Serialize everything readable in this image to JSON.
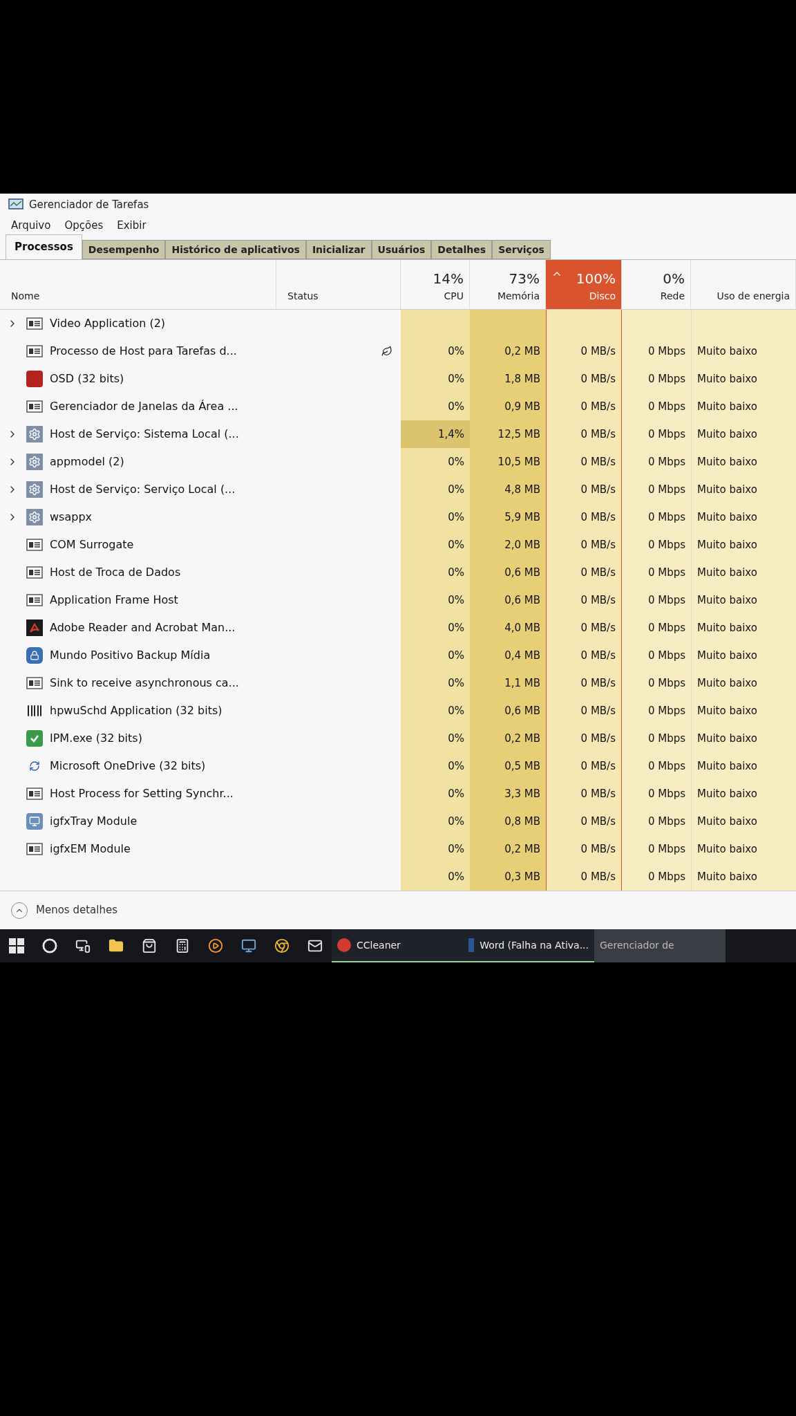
{
  "window": {
    "title": "Gerenciador de Tarefas"
  },
  "menu": [
    "Arquivo",
    "Opções",
    "Exibir"
  ],
  "tabs": [
    {
      "label": "Processos",
      "selected": true
    },
    {
      "label": "Desempenho",
      "selected": false
    },
    {
      "label": "Histórico de aplicativos",
      "selected": false
    },
    {
      "label": "Inicializar",
      "selected": false
    },
    {
      "label": "Usuários",
      "selected": false
    },
    {
      "label": "Detalhes",
      "selected": false
    },
    {
      "label": "Serviços",
      "selected": false
    }
  ],
  "table": {
    "columns": [
      {
        "label": "Nome",
        "alert": false,
        "sorted": false
      },
      {
        "label": "Status",
        "alert": false,
        "sorted": false
      },
      {
        "label": "CPU",
        "total": "14%",
        "alert": false,
        "sorted": false
      },
      {
        "label": "Memória",
        "total": "73%",
        "alert": false,
        "sorted": false
      },
      {
        "label": "Disco",
        "total": "100%",
        "alert": true,
        "sorted": true
      },
      {
        "label": "Rede",
        "total": "0%",
        "alert": false,
        "sorted": false
      },
      {
        "label": "Uso de energia",
        "alert": false,
        "sorted": false
      }
    ],
    "rows": [
      {
        "name": "Video Application (2)",
        "kind": "window",
        "expandable": true,
        "suspended": false,
        "cpu_high": false
      },
      {
        "name": "Processo de Host para Tarefas d...",
        "kind": "window",
        "expandable": false,
        "suspended": true,
        "cpu_high": false,
        "cpu": "0%",
        "memory": "0,2 MB",
        "disk": "0 MB/s",
        "network": "0 Mbps",
        "power": "Muito baixo"
      },
      {
        "name": "OSD (32 bits)",
        "kind": "osd",
        "expandable": false,
        "suspended": false,
        "cpu_high": false,
        "cpu": "0%",
        "memory": "1,8 MB",
        "disk": "0 MB/s",
        "network": "0 Mbps",
        "power": "Muito baixo"
      },
      {
        "name": "Gerenciador de Janelas da Área ...",
        "kind": "window",
        "expandable": false,
        "suspended": false,
        "cpu_high": false,
        "cpu": "0%",
        "memory": "0,9 MB",
        "disk": "0 MB/s",
        "network": "0 Mbps",
        "power": "Muito baixo"
      },
      {
        "name": "Host de Serviço: Sistema Local (...",
        "kind": "gear",
        "expandable": true,
        "suspended": false,
        "cpu_high": true,
        "cpu": "1,4%",
        "memory": "12,5 MB",
        "disk": "0 MB/s",
        "network": "0 Mbps",
        "power": "Muito baixo"
      },
      {
        "name": "appmodel (2)",
        "kind": "gear",
        "expandable": true,
        "suspended": false,
        "cpu_high": false,
        "cpu": "0%",
        "memory": "10,5 MB",
        "disk": "0 MB/s",
        "network": "0 Mbps",
        "power": "Muito baixo"
      },
      {
        "name": "Host de Serviço: Serviço Local (...",
        "kind": "gear",
        "expandable": true,
        "suspended": false,
        "cpu_high": false,
        "cpu": "0%",
        "memory": "4,8 MB",
        "disk": "0 MB/s",
        "network": "0 Mbps",
        "power": "Muito baixo"
      },
      {
        "name": "wsappx",
        "kind": "gear",
        "expandable": true,
        "suspended": false,
        "cpu_high": false,
        "cpu": "0%",
        "memory": "5,9 MB",
        "disk": "0 MB/s",
        "network": "0 Mbps",
        "power": "Muito baixo"
      },
      {
        "name": "COM Surrogate",
        "kind": "window",
        "expandable": false,
        "suspended": false,
        "cpu_high": false,
        "cpu": "0%",
        "memory": "2,0 MB",
        "disk": "0 MB/s",
        "network": "0 Mbps",
        "power": "Muito baixo"
      },
      {
        "name": "Host de Troca de Dados",
        "kind": "window",
        "expandable": false,
        "suspended": false,
        "cpu_high": false,
        "cpu": "0%",
        "memory": "0,6 MB",
        "disk": "0 MB/s",
        "network": "0 Mbps",
        "power": "Muito baixo"
      },
      {
        "name": "Application Frame Host",
        "kind": "window",
        "expandable": false,
        "suspended": false,
        "cpu_high": false,
        "cpu": "0%",
        "memory": "0,6 MB",
        "disk": "0 MB/s",
        "network": "0 Mbps",
        "power": "Muito baixo"
      },
      {
        "name": "Adobe Reader and Acrobat Man...",
        "kind": "adobe",
        "expandable": false,
        "suspended": false,
        "cpu_high": false,
        "cpu": "0%",
        "memory": "4,0 MB",
        "disk": "0 MB/s",
        "network": "0 Mbps",
        "power": "Muito baixo"
      },
      {
        "name": "Mundo Positivo Backup Mídia",
        "kind": "lock",
        "expandable": false,
        "suspended": false,
        "cpu_high": false,
        "cpu": "0%",
        "memory": "0,4 MB",
        "disk": "0 MB/s",
        "network": "0 Mbps",
        "power": "Muito baixo"
      },
      {
        "name": "Sink to receive asynchronous ca...",
        "kind": "window",
        "expandable": false,
        "suspended": false,
        "cpu_high": false,
        "cpu": "0%",
        "memory": "1,1 MB",
        "disk": "0 MB/s",
        "network": "0 Mbps",
        "power": "Muito baixo"
      },
      {
        "name": "hpwuSchd Application (32 bits)",
        "kind": "barcode",
        "expandable": false,
        "suspended": false,
        "cpu_high": false,
        "cpu": "0%",
        "memory": "0,6 MB",
        "disk": "0 MB/s",
        "network": "0 Mbps",
        "power": "Muito baixo"
      },
      {
        "name": "IPM.exe (32 bits)",
        "kind": "ipm",
        "expandable": false,
        "suspended": false,
        "cpu_high": false,
        "cpu": "0%",
        "memory": "0,2 MB",
        "disk": "0 MB/s",
        "network": "0 Mbps",
        "power": "Muito baixo"
      },
      {
        "name": "Microsoft OneDrive (32 bits)",
        "kind": "sync",
        "expandable": false,
        "suspended": false,
        "cpu_high": false,
        "cpu": "0%",
        "memory": "0,5 MB",
        "disk": "0 MB/s",
        "network": "0 Mbps",
        "power": "Muito baixo"
      },
      {
        "name": "Host Process for Setting Synchr...",
        "kind": "window",
        "expandable": false,
        "suspended": false,
        "cpu_high": false,
        "cpu": "0%",
        "memory": "3,3 MB",
        "disk": "0 MB/s",
        "network": "0 Mbps",
        "power": "Muito baixo"
      },
      {
        "name": "igfxTray Module",
        "kind": "monitor",
        "expandable": false,
        "suspended": false,
        "cpu_high": false,
        "cpu": "0%",
        "memory": "0,8 MB",
        "disk": "0 MB/s",
        "network": "0 Mbps",
        "power": "Muito baixo"
      },
      {
        "name": "igfxEM Module",
        "kind": "window",
        "expandable": false,
        "suspended": false,
        "cpu_high": false,
        "cpu": "0%",
        "memory": "0,2 MB",
        "disk": "0 MB/s",
        "network": "0 Mbps",
        "power": "Muito baixo"
      },
      {
        "kind": "none",
        "expandable": false,
        "suspended": false,
        "cpu_high": false,
        "cpu": "0%",
        "memory": "0,3 MB",
        "disk": "0 MB/s",
        "network": "0 Mbps",
        "power": "Muito baixo"
      }
    ]
  },
  "footer": {
    "label": "Menos detalhes"
  },
  "taskbar": {
    "icons": [
      {
        "kind": "start"
      },
      {
        "kind": "search"
      },
      {
        "kind": "taskview"
      },
      {
        "kind": "folder"
      },
      {
        "kind": "store"
      },
      {
        "kind": "calculator"
      },
      {
        "kind": "media"
      },
      {
        "kind": "remote"
      },
      {
        "kind": "chrome"
      },
      {
        "kind": "mail"
      }
    ],
    "apps": [
      {
        "label": "CCleaner",
        "kind": "ccleaner",
        "active": false
      },
      {
        "label": "Word (Falha na Ativa...",
        "kind": "word",
        "active": false
      },
      {
        "label": "Gerenciador de",
        "kind": "none",
        "active": true
      }
    ]
  }
}
